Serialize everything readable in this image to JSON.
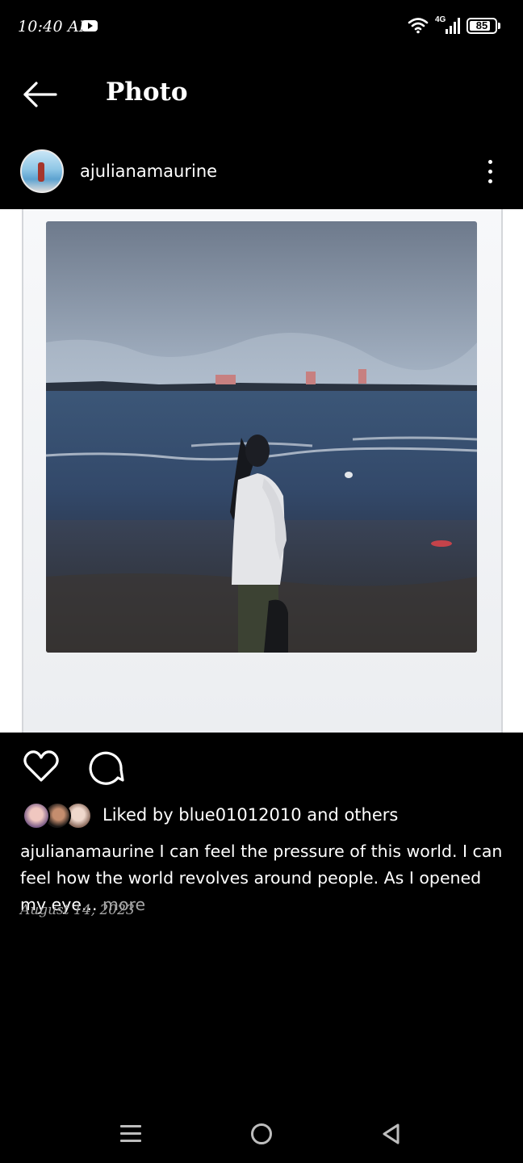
{
  "status_bar": {
    "time": "10:40 AM",
    "network": "4G",
    "battery": "85",
    "battery_level": 0.85,
    "icons": [
      "youtube-icon",
      "wifi-icon",
      "signal-icon",
      "battery-icon"
    ]
  },
  "header": {
    "title": "Photo",
    "back_icon": "arrow-left-icon"
  },
  "post": {
    "username": "ajulianamaurine",
    "more_icon": "more-vertical-icon",
    "photo_alt": "Woman in white shirt standing on a beach looking at the sea",
    "liked_by_text": "Liked by blue01012010 and others",
    "caption_user": "ajulianamaurine",
    "caption_text": " I can feel the pressure of this world. I can feel how the world revolves around people. As I opened my eye...",
    "caption_more": " more",
    "date": "August 14, 2023"
  },
  "actions": {
    "like_icon": "heart-icon",
    "comment_icon": "comment-icon"
  },
  "nav_bar": {
    "icons": [
      "menu-icon",
      "home-icon",
      "back-triangle-icon"
    ]
  },
  "colors": {
    "background": "#000000",
    "text": "#ffffff",
    "muted": "#a8a8a8"
  }
}
